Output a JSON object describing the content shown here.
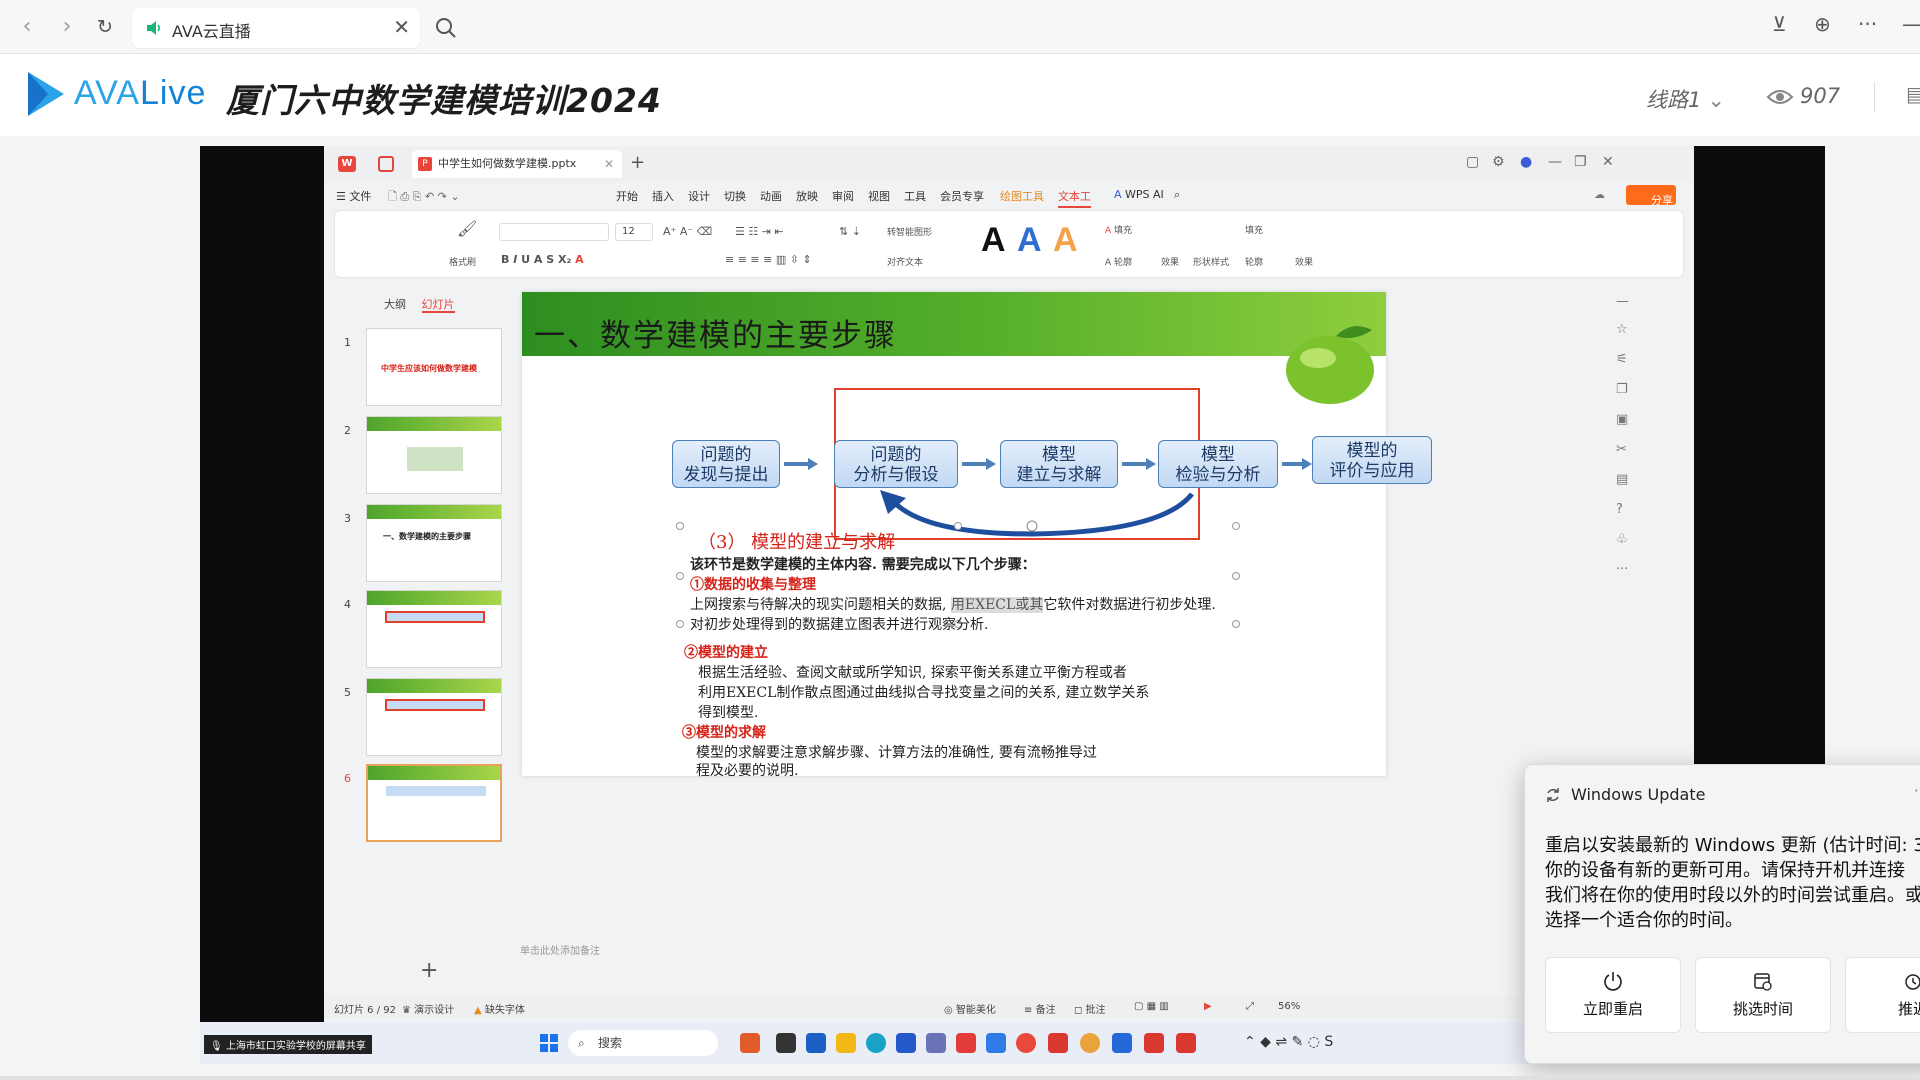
{
  "browser": {
    "tab_title": "AVA云直播",
    "back_icon": "back-arrow-icon",
    "forward_icon": "forward-arrow-icon",
    "reload_icon": "reload-icon"
  },
  "header": {
    "logo_ava": "AVA",
    "logo_live": "Live",
    "title": "厦门六中数学建模培训2024",
    "line_select": "线路1",
    "viewer_count": "907"
  },
  "wps": {
    "doc_tab": "中学生如何做数学建模.pptx",
    "menu": {
      "file": "文件",
      "items": [
        "开始",
        "插入",
        "设计",
        "切换",
        "动画",
        "放映",
        "审阅",
        "视图",
        "工具",
        "会员专享",
        "绘图工具",
        "文本工"
      ],
      "ai": "WPS AI",
      "share": "分享"
    },
    "ribbon": {
      "format_painter": "格式刷",
      "font_size": "12",
      "convert_shape": "转智能图形",
      "align_text": "对齐文本",
      "fill": "填充",
      "outline": "轮廓",
      "effect": "效果",
      "shape_style": "形状样式",
      "fill2": "填充",
      "outline2": "轮廓",
      "effect2": "效果"
    },
    "left_panel": {
      "tab_outline": "大纲",
      "tab_slides": "幻灯片",
      "thumbs": [
        {
          "num": "1",
          "caption": "中学生应该如何做数学建模"
        },
        {
          "num": "2",
          "caption": ""
        },
        {
          "num": "3",
          "caption": "一、数学建模的主要步骤"
        },
        {
          "num": "4",
          "caption": ""
        },
        {
          "num": "5",
          "caption": ""
        },
        {
          "num": "6",
          "caption": ""
        }
      ]
    },
    "slide": {
      "heading": "一、数学建模的主要步骤",
      "flow": [
        {
          "line1": "问题的",
          "line2": "发现与提出"
        },
        {
          "line1": "问题的",
          "line2": "分析与假设"
        },
        {
          "line1": "模型",
          "line2": "建立与求解"
        },
        {
          "line1": "模型",
          "line2": "检验与分析"
        },
        {
          "line1": "模型的",
          "line2": "评价与应用"
        }
      ],
      "section_title": "（3） 模型的建立与求解",
      "intro": "该环节是数学建模的主体内容. 需要完成以下几个步骤：",
      "step1_title": "①数据的收集与整理",
      "step1_a_pre": "上网搜索与待解决的现实问题相关的数据, ",
      "step1_a_hl": "用EXECL或其",
      "step1_a_post": "它软件对数据进行初步处理.",
      "step1_b": "对初步处理得到的数据建立图表并进行观察分析.",
      "step2_title": "②模型的建立",
      "step2_a": "根据生活经验、查阅文献或所学知识, 探索平衡关系建立平衡方程或者",
      "step2_b": "利用EXECL制作散点图通过曲线拟合寻找变量之间的关系, 建立数学关系",
      "step2_c": "得到模型.",
      "step3_title": "③模型的求解",
      "step3_a": "模型的求解要注意求解步骤、计算方法的准确性, 要有流畅推导过",
      "step3_b": "程及必要的说明."
    },
    "note_hint": "单击此处添加备注",
    "status": {
      "slide_pos": "幻灯片 6 / 92",
      "design": "演示设计",
      "missing_font": "缺失字体",
      "beautify": "智能美化",
      "notes": "备注",
      "comment": "批注",
      "zoom": "56%"
    }
  },
  "taskbar": {
    "share_label": "上海市虹口实验学校的屏幕共享",
    "search": "搜索"
  },
  "toast": {
    "app": "Windows Update",
    "body_line1": "重启以安装最新的 Windows 更新 (估计时间: 3",
    "body_line2": "你的设备有新的更新可用。请保持开机并连接",
    "body_line3": "我们将在你的使用时段以外的时间尝试重启。或",
    "body_line4": "选择一个适合你的时间。",
    "btn_restart": "立即重启",
    "btn_pick_time": "挑选时间",
    "btn_postpone": "推迟"
  },
  "colors": {
    "accent_red": "#e8463c",
    "slide_green": "#57b02b",
    "flow_blue": "#4d7fb8",
    "logo_blue": "#2aa3e8"
  }
}
